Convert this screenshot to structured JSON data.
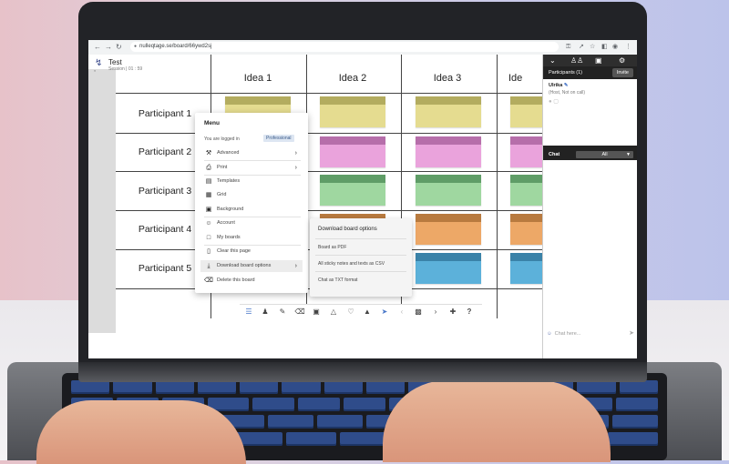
{
  "browser": {
    "url": "nulleqtage.se/board/66ywd2sj",
    "nav": {
      "back": "←",
      "forward": "→",
      "reload": "↻"
    }
  },
  "board": {
    "title": "Test",
    "session": "Session | 01 : 59",
    "columns": [
      "Idea 1",
      "Idea 2",
      "Idea 3",
      "Ide"
    ],
    "rows": [
      "Participant 1",
      "Participant 2",
      "Participant 3",
      "Participant 4",
      "Participant 5"
    ]
  },
  "participants_panel": {
    "title": "Participants (1)",
    "invite_label": "Invite",
    "user_name": "Ulrika",
    "user_status": "(Host, Not on call)"
  },
  "chat": {
    "title": "Chat",
    "filter": "All",
    "input_placeholder": "Chat here..."
  },
  "menu": {
    "title": "Menu",
    "logged_in_text": "You are logged in",
    "plan_badge": "Professional",
    "items": [
      {
        "label": "Advanced",
        "icon": "tools-icon"
      },
      {
        "label": "Print",
        "icon": "printer-icon"
      },
      {
        "label": "Templates",
        "icon": "templates-icon"
      },
      {
        "label": "Grid",
        "icon": "grid-icon"
      },
      {
        "label": "Background",
        "icon": "image-icon"
      },
      {
        "label": "Account",
        "icon": "user-icon"
      },
      {
        "label": "My boards",
        "icon": "monitor-icon"
      },
      {
        "label": "Clear this page",
        "icon": "clear-page-icon"
      },
      {
        "label": "Download board options",
        "icon": "download-icon"
      },
      {
        "label": "Delete this board",
        "icon": "trash-icon"
      }
    ]
  },
  "submenu": {
    "title": "Download board options",
    "items": [
      "Board as PDF",
      "All sticky notes and texts as CSV",
      "Chat as TXT format"
    ]
  },
  "colors": {
    "note_yellow": "#e5dc90",
    "note_yellow_strip": "#b3ac5f",
    "note_pink": "#eaa3dc",
    "note_pink_strip": "#b66eaa",
    "note_green": "#9fd7a0",
    "note_green_strip": "#5f9d67",
    "note_orange": "#eda867",
    "note_orange_strip": "#b87a3f",
    "note_blue": "#5cb1da",
    "note_blue_strip": "#3a82a8",
    "accent": "#4a78c9"
  }
}
